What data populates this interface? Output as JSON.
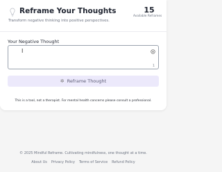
{
  "header": {
    "title": "Reframe Your Thoughts",
    "subtitle": "Transform negative thinking into positive perspectives.",
    "stat_number": "15",
    "stat_label": "Available Reframes"
  },
  "form": {
    "label": "Your Negative Thought",
    "value": "I",
    "counter": "1",
    "button_label": "Reframe Thought"
  },
  "disclaimer": "This is a tool, not a therapist. For mental health concerns please consult a professional.",
  "footer": {
    "copyright": "© 2025 Mindful Reframe. Cultivating mindfulness, one thought at a time.",
    "links": [
      "About Us",
      "Privacy Policy",
      "Terms of Service",
      "Refund Policy"
    ]
  },
  "colors": {
    "button_bg": "#ece9fb",
    "input_border": "#9aa2ae",
    "page_bg": "#f5f5f5"
  },
  "icons": {
    "header": "lightbulb-icon",
    "clear": "clear-icon",
    "button": "sparkle-icon"
  }
}
